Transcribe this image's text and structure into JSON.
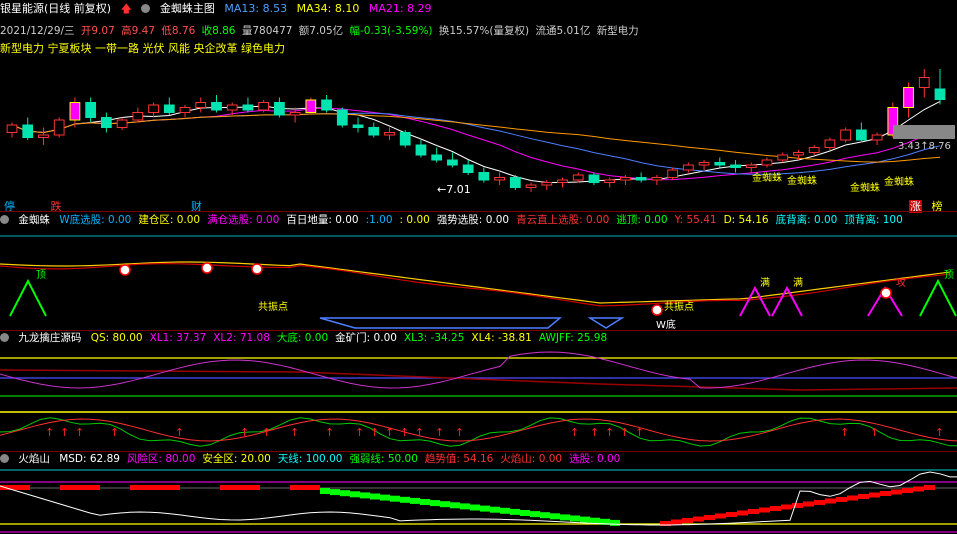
{
  "title": {
    "stock": "银星能源(日线 前复权)",
    "indicator": "金蜘蛛主图",
    "ma13": "MA13: 8.53",
    "ma34": "MA34: 8.10",
    "ma21": "MA21: 8.29"
  },
  "info": {
    "date": "2021/12/29/三",
    "open": "开9.07",
    "high": "高9.47",
    "low": "低8.76",
    "close": "收8.86",
    "volume": "量780477",
    "amount": "额7.05亿",
    "change": "幅-0.33(-3.59%)",
    "turnover": "换15.57%(量复权)",
    "float": "流通5.01亿",
    "concept": "新型电力"
  },
  "concepts": "新型电力 宁夏板块 一带一路 光伏 风能 央企改革 绿色电力",
  "main_chart": {
    "price_label": "7.01",
    "right_label": "3.43↑8.76",
    "tags": [
      "金蜘蛛",
      "金蜘蛛",
      "金蜘蛛",
      "金蜘蛛"
    ],
    "bottom_left": [
      "停",
      "跌",
      "财"
    ],
    "bottom_right": [
      "涨",
      "榜"
    ]
  },
  "panel1": {
    "name": "金蜘蛛",
    "fields": [
      {
        "text": "W底选股: 0.00",
        "color": "#00b4ff"
      },
      {
        "text": "建仓区: 0.00",
        "color": "#ffff00"
      },
      {
        "text": "满仓选股: 0.00",
        "color": "#ff00ff"
      },
      {
        "text": "百日地量: 0.00",
        "color": "#ffffff"
      },
      {
        "text": ":1.00",
        "color": "#00b4ff"
      },
      {
        "text": ": 0.00",
        "color": "#ffff00"
      },
      {
        "text": "强势选股: 0.00",
        "color": "#ffffff"
      },
      {
        "text": "青云直上选股: 0.00",
        "color": "#ff3030"
      },
      {
        "text": "逃顶: 0.00",
        "color": "#00ff00"
      },
      {
        "text": "Y: 55.41",
        "color": "#ff3030"
      },
      {
        "text": "D: 54.16",
        "color": "#ffff00"
      },
      {
        "text": "底背离: 0.00",
        "color": "#00ffff"
      },
      {
        "text": "顶背离: 100",
        "color": "#00ffff"
      }
    ],
    "labels": [
      "顶",
      "共振点",
      "满",
      "满",
      "攻",
      "顶",
      "共振点",
      "W底"
    ]
  },
  "panel2": {
    "name": "九龙擒庄源码",
    "fields": [
      {
        "text": "QS: 80.00",
        "color": "#ffff00"
      },
      {
        "text": "XL1: 37.37",
        "color": "#ff00ff"
      },
      {
        "text": "XL2: 71.08",
        "color": "#ff00ff"
      },
      {
        "text": "大底: 0.00",
        "color": "#00ff00"
      },
      {
        "text": "金矿门: 0.00",
        "color": "#ffffff"
      },
      {
        "text": "XL3: -34.25",
        "color": "#00ff00"
      },
      {
        "text": "XL4: -38.81",
        "color": "#ffff00"
      },
      {
        "text": "AWJFF: 25.98",
        "color": "#00ff00"
      }
    ]
  },
  "panel3": {
    "name": "火焰山",
    "fields": [
      {
        "text": "MSD: 62.89",
        "color": "#ffffff"
      },
      {
        "text": "风险区: 80.00",
        "color": "#ff00ff"
      },
      {
        "text": "安全区: 20.00",
        "color": "#ffff00"
      },
      {
        "text": "天线: 100.00",
        "color": "#00ffff"
      },
      {
        "text": "强弱线: 50.00",
        "color": "#00ff00"
      },
      {
        "text": "趋势值: 54.16",
        "color": "#ff3030"
      },
      {
        "text": "火焰山: 0.00",
        "color": "#ff3030"
      },
      {
        "text": "选股: 0.00",
        "color": "#ff00ff"
      }
    ]
  },
  "colors": {
    "up": "#ff3333",
    "down": "#00e5b0",
    "ma13": "#ffffff",
    "ma21": "#ff00ff",
    "ma34": "#4d7fff",
    "ma60": "#ff9900"
  },
  "chart_data": {
    "type": "candlestick",
    "candles": [
      [
        8.2,
        8.4,
        8.1,
        8.35
      ],
      [
        8.35,
        8.5,
        8.05,
        8.1
      ],
      [
        8.1,
        8.3,
        7.95,
        8.15
      ],
      [
        8.15,
        8.5,
        8.1,
        8.45
      ],
      [
        8.45,
        8.9,
        8.3,
        8.8
      ],
      [
        8.8,
        8.9,
        8.4,
        8.5
      ],
      [
        8.5,
        8.6,
        8.2,
        8.3
      ],
      [
        8.3,
        8.5,
        8.25,
        8.45
      ],
      [
        8.45,
        8.7,
        8.4,
        8.6
      ],
      [
        8.6,
        8.8,
        8.5,
        8.75
      ],
      [
        8.75,
        8.9,
        8.55,
        8.6
      ],
      [
        8.6,
        8.75,
        8.5,
        8.7
      ],
      [
        8.7,
        8.9,
        8.6,
        8.8
      ],
      [
        8.8,
        8.95,
        8.6,
        8.65
      ],
      [
        8.65,
        8.8,
        8.55,
        8.75
      ],
      [
        8.75,
        8.9,
        8.6,
        8.65
      ],
      [
        8.65,
        8.85,
        8.6,
        8.8
      ],
      [
        8.8,
        8.9,
        8.5,
        8.55
      ],
      [
        8.55,
        8.7,
        8.4,
        8.6
      ],
      [
        8.6,
        8.9,
        8.55,
        8.85
      ],
      [
        8.85,
        8.95,
        8.6,
        8.65
      ],
      [
        8.65,
        8.7,
        8.3,
        8.35
      ],
      [
        8.35,
        8.5,
        8.2,
        8.3
      ],
      [
        8.3,
        8.4,
        8.1,
        8.15
      ],
      [
        8.15,
        8.3,
        8.05,
        8.2
      ],
      [
        8.2,
        8.25,
        7.9,
        7.95
      ],
      [
        7.95,
        8.05,
        7.7,
        7.75
      ],
      [
        7.75,
        7.9,
        7.6,
        7.65
      ],
      [
        7.65,
        7.8,
        7.5,
        7.55
      ],
      [
        7.55,
        7.65,
        7.35,
        7.4
      ],
      [
        7.4,
        7.5,
        7.2,
        7.25
      ],
      [
        7.25,
        7.4,
        7.15,
        7.3
      ],
      [
        7.3,
        7.35,
        7.05,
        7.1
      ],
      [
        7.1,
        7.2,
        7.01,
        7.15
      ],
      [
        7.15,
        7.25,
        7.05,
        7.2
      ],
      [
        7.2,
        7.3,
        7.1,
        7.25
      ],
      [
        7.25,
        7.4,
        7.2,
        7.35
      ],
      [
        7.35,
        7.4,
        7.15,
        7.2
      ],
      [
        7.2,
        7.3,
        7.1,
        7.25
      ],
      [
        7.25,
        7.35,
        7.15,
        7.3
      ],
      [
        7.3,
        7.4,
        7.2,
        7.25
      ],
      [
        7.25,
        7.35,
        7.15,
        7.3
      ],
      [
        7.3,
        7.5,
        7.25,
        7.45
      ],
      [
        7.45,
        7.6,
        7.4,
        7.55
      ],
      [
        7.55,
        7.65,
        7.45,
        7.6
      ],
      [
        7.6,
        7.7,
        7.5,
        7.55
      ],
      [
        7.55,
        7.65,
        7.4,
        7.5
      ],
      [
        7.5,
        7.6,
        7.4,
        7.55
      ],
      [
        7.55,
        7.7,
        7.5,
        7.65
      ],
      [
        7.65,
        7.8,
        7.6,
        7.75
      ],
      [
        7.75,
        7.85,
        7.65,
        7.8
      ],
      [
        7.8,
        7.95,
        7.75,
        7.9
      ],
      [
        7.9,
        8.1,
        7.85,
        8.05
      ],
      [
        8.05,
        8.3,
        8.0,
        8.25
      ],
      [
        8.25,
        8.4,
        8.0,
        8.05
      ],
      [
        8.05,
        8.2,
        7.95,
        8.15
      ],
      [
        8.15,
        8.8,
        8.1,
        8.7
      ],
      [
        8.7,
        9.2,
        8.5,
        9.1
      ],
      [
        9.1,
        9.47,
        8.9,
        9.3
      ],
      [
        9.07,
        9.47,
        8.76,
        8.86
      ]
    ]
  }
}
